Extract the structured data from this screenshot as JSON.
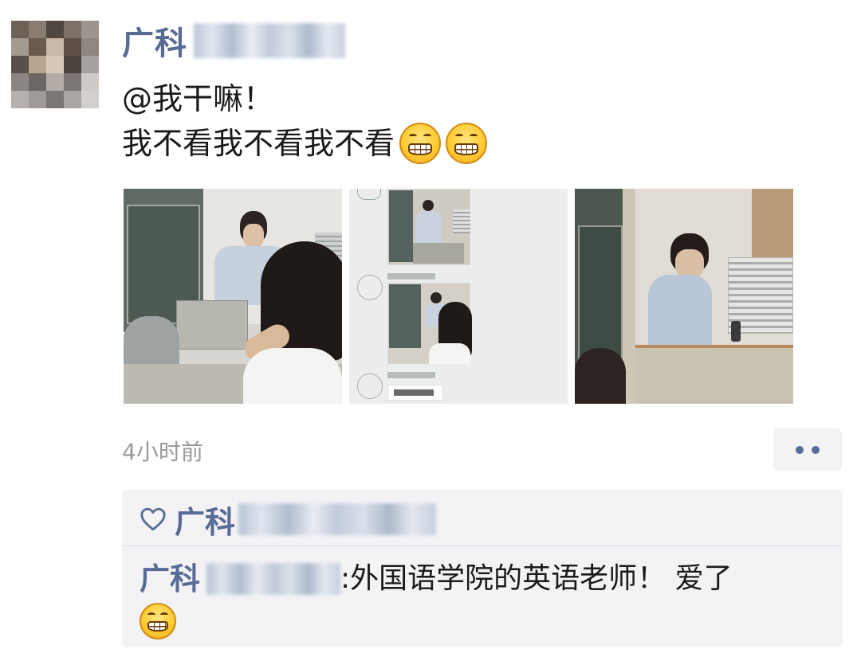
{
  "post": {
    "author_name": "广科",
    "text_line1": "@我干嘛！",
    "text_line2": "我不看我不看我不看",
    "text_emojis": [
      "grin-emoji",
      "grin-emoji"
    ],
    "timestamp": "4小时前"
  },
  "photos": [
    {
      "name": "classroom-photo-teacher-with-student"
    },
    {
      "name": "screenshot-collage-photo"
    },
    {
      "name": "classroom-photo-teacher-at-podium"
    }
  ],
  "interaction": {
    "like_icon": "heart-icon",
    "liker_name": "广科",
    "comment": {
      "commenter_name": "广科",
      "separator": ":",
      "text": " 外国语学院的英语老师！ 爱了",
      "emoji": "grin-emoji"
    }
  },
  "colors": {
    "link_blue": "#576b95",
    "timestamp_gray": "#9a9a9a",
    "panel_bg": "#f3f3f5"
  },
  "more_menu": {
    "icon": "more-dots-icon"
  }
}
